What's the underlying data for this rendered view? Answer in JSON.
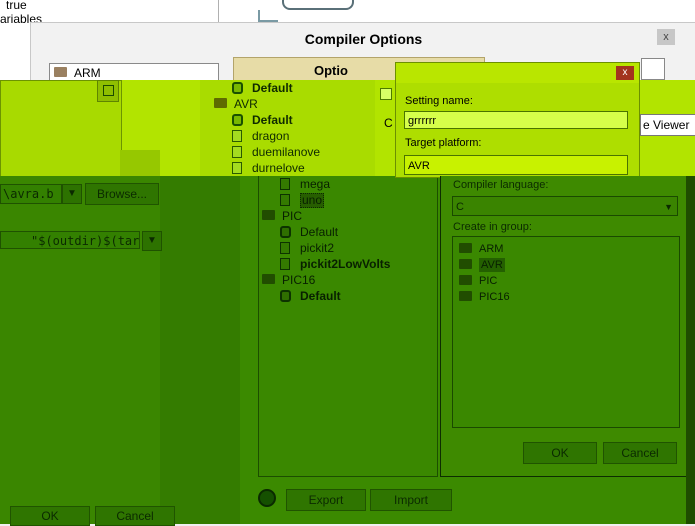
{
  "background": {
    "true_text": "true",
    "variables_text": "ariables"
  },
  "compiler_options": {
    "title": "Compiler Options",
    "close_glyph": "x",
    "tree_first_item": "ARM",
    "tab_label": "Optio",
    "flow_viewer_label": "e Viewer",
    "path_value": "\\avra.b",
    "browse_label": "Browse...",
    "args_value": "\"$(outdir)$(tar",
    "ok_label": "OK",
    "cancel_label": "Cancel",
    "export_label": "Export",
    "import_label": "Import",
    "tree": [
      {
        "type": "item",
        "icon": "lock-icon",
        "label": "Default",
        "bold": true
      },
      {
        "type": "group",
        "icon": "folder-icon",
        "label": "AVR",
        "bold": false
      },
      {
        "type": "item",
        "icon": "lock-icon",
        "label": "Default",
        "bold": true
      },
      {
        "type": "item",
        "icon": "document-icon",
        "label": "dragon",
        "bold": false
      },
      {
        "type": "item",
        "icon": "document-icon",
        "label": "duemilanove",
        "bold": false
      },
      {
        "type": "item",
        "icon": "document-icon",
        "label": "durnelove",
        "bold": false
      },
      {
        "type": "item",
        "icon": "document-icon",
        "label": "mega",
        "bold": false
      },
      {
        "type": "item",
        "icon": "document-icon",
        "label": "uno",
        "bold": false,
        "selected": true
      },
      {
        "type": "group",
        "icon": "folder-icon",
        "label": "PIC",
        "bold": false
      },
      {
        "type": "item",
        "icon": "lock-icon",
        "label": "Default",
        "bold": false
      },
      {
        "type": "item",
        "icon": "document-icon",
        "label": "pickit2",
        "bold": false
      },
      {
        "type": "item",
        "icon": "document-icon",
        "label": "pickit2LowVolts",
        "bold": false
      },
      {
        "type": "group",
        "icon": "folder-icon",
        "label": "PIC16",
        "bold": false
      },
      {
        "type": "item",
        "icon": "lock-icon",
        "label": "Default",
        "bold": true
      }
    ]
  },
  "new_setting_dialog": {
    "close_glyph": "x",
    "setting_name_label": "Setting name:",
    "setting_name_value": "grrrrrr",
    "target_platform_label": "Target platform:",
    "target_platform_value": "AVR",
    "compiler_language_label": "Compiler language:",
    "compiler_language_value": "C",
    "create_in_group_label": "Create in group:",
    "groups": [
      "ARM",
      "AVR",
      "PIC",
      "PIC16"
    ],
    "selected_group": "AVR",
    "ok_label": "OK",
    "cancel_label": "Cancel"
  }
}
